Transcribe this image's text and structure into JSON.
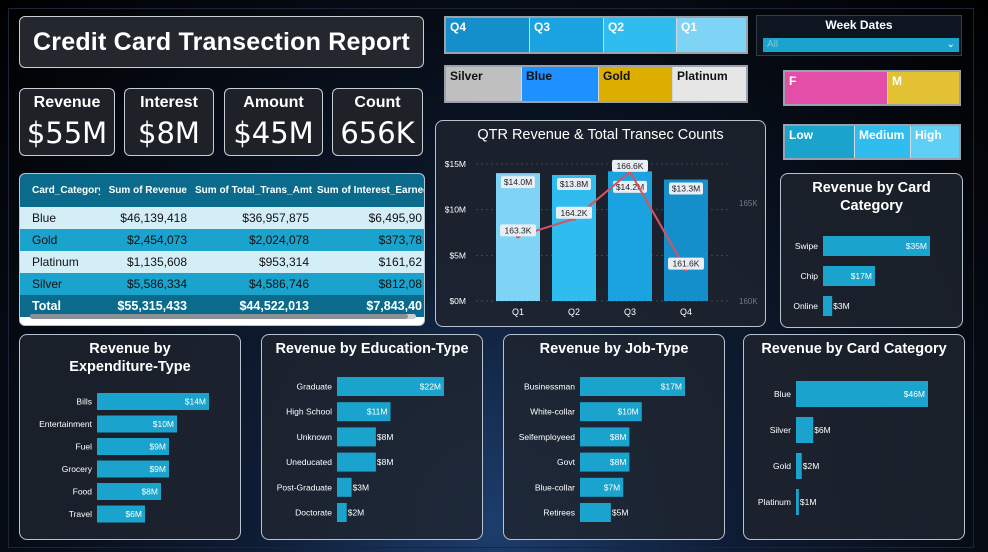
{
  "title": "Credit Card Transection Report",
  "kpis": [
    {
      "label": "Revenue",
      "value": "$55M"
    },
    {
      "label": "Interest",
      "value": "$8M"
    },
    {
      "label": "Amount",
      "value": "$45M"
    },
    {
      "label": "Count",
      "value": "656K"
    }
  ],
  "slicers": {
    "quarters": [
      "Q4",
      "Q3",
      "Q2",
      "Q1"
    ],
    "categories": [
      "Silver",
      "Blue",
      "Gold",
      "Platinum"
    ],
    "week_dates": {
      "label": "Week Dates",
      "value": "All"
    },
    "gender": [
      "F",
      "M"
    ],
    "income": [
      "Low",
      "Medium",
      "High"
    ]
  },
  "table": {
    "headers": [
      "Card_Category",
      "Sum of Revenue",
      "Sum of Total_Trans_Amt",
      "Sum of Interest_Earned"
    ],
    "rows": [
      [
        "Blue",
        "$46,139,418",
        "$36,957,875",
        "$6,495,90"
      ],
      [
        "Gold",
        "$2,454,073",
        "$2,024,078",
        "$373,78"
      ],
      [
        "Platinum",
        "$1,135,608",
        "$953,314",
        "$161,62"
      ],
      [
        "Silver",
        "$5,586,334",
        "$4,586,746",
        "$812,08"
      ]
    ],
    "total": [
      "Total",
      "$55,315,433",
      "$44,522,013",
      "$7,843,40"
    ]
  },
  "colors": {
    "bar": "#1aa3cc",
    "q1": "#7fd3f5",
    "q2": "#2fbdf0",
    "q3": "#1aa3e0",
    "q4": "#158fcc",
    "line": "#d9525e",
    "silver": "#bfbfbf",
    "blue": "#1e90ff",
    "gold": "#dbae00",
    "platinum": "#e6e6e6",
    "female": "#e34fa8",
    "male": "#e2c232"
  },
  "chart_data": [
    {
      "type": "bar",
      "title": "QTR Revenue & Total Transec Counts",
      "categories": [
        "Q1",
        "Q2",
        "Q3",
        "Q4"
      ],
      "series": [
        {
          "values": [
            14.0,
            13.8,
            14.2,
            13.3
          ],
          "labels": [
            "$14.0M",
            "$13.8M",
            "$14.2M",
            "$13.3M"
          ]
        },
        {
          "type": "line",
          "values": [
            163.3,
            164.2,
            166.6,
            161.6
          ],
          "labels": [
            "163.3K",
            "164.2K",
            "166.6K",
            "161.6K"
          ]
        }
      ],
      "yticks": [
        "$0M",
        "$5M",
        "$10M",
        "$15M"
      ],
      "ylim": [
        0,
        15
      ],
      "y2ticks": [
        "160K",
        "165K"
      ],
      "y2lim": [
        160,
        167
      ]
    },
    {
      "type": "bar",
      "title": "Revenue by Card Category",
      "orientation": "horizontal",
      "categories": [
        "Swipe",
        "Chip",
        "Online"
      ],
      "values": [
        35,
        17,
        3
      ],
      "labels": [
        "$35M",
        "$17M",
        "$3M"
      ]
    },
    {
      "type": "bar",
      "title": "Revenue by Expenditure-Type",
      "orientation": "horizontal",
      "categories": [
        "Bills",
        "Entertainment",
        "Fuel",
        "Grocery",
        "Food",
        "Travel"
      ],
      "values": [
        14,
        10,
        9,
        9,
        8,
        6
      ],
      "labels": [
        "$14M",
        "$10M",
        "$9M",
        "$9M",
        "$8M",
        "$6M"
      ]
    },
    {
      "type": "bar",
      "title": "Revenue by Education-Type",
      "orientation": "horizontal",
      "categories": [
        "Graduate",
        "High School",
        "Unknown",
        "Uneducated",
        "Post-Graduate",
        "Doctorate"
      ],
      "values": [
        22,
        11,
        8,
        8,
        3,
        2
      ],
      "labels": [
        "$22M",
        "$11M",
        "$8M",
        "$8M",
        "$3M",
        "$2M"
      ]
    },
    {
      "type": "bar",
      "title": "Revenue by Job-Type",
      "orientation": "horizontal",
      "categories": [
        "Businessman",
        "White-collar",
        "Selfemployeed",
        "Govt",
        "Blue-collar",
        "Retirees"
      ],
      "values": [
        17,
        10,
        8,
        8,
        7,
        5
      ],
      "labels": [
        "$17M",
        "$10M",
        "$8M",
        "$8M",
        "$7M",
        "$5M"
      ]
    },
    {
      "type": "bar",
      "title": "Revenue by Card Category",
      "orientation": "horizontal",
      "categories": [
        "Blue",
        "Silver",
        "Gold",
        "Platinum"
      ],
      "values": [
        46,
        6,
        2,
        1
      ],
      "labels": [
        "$46M",
        "$6M",
        "$2M",
        "$1M"
      ]
    }
  ]
}
